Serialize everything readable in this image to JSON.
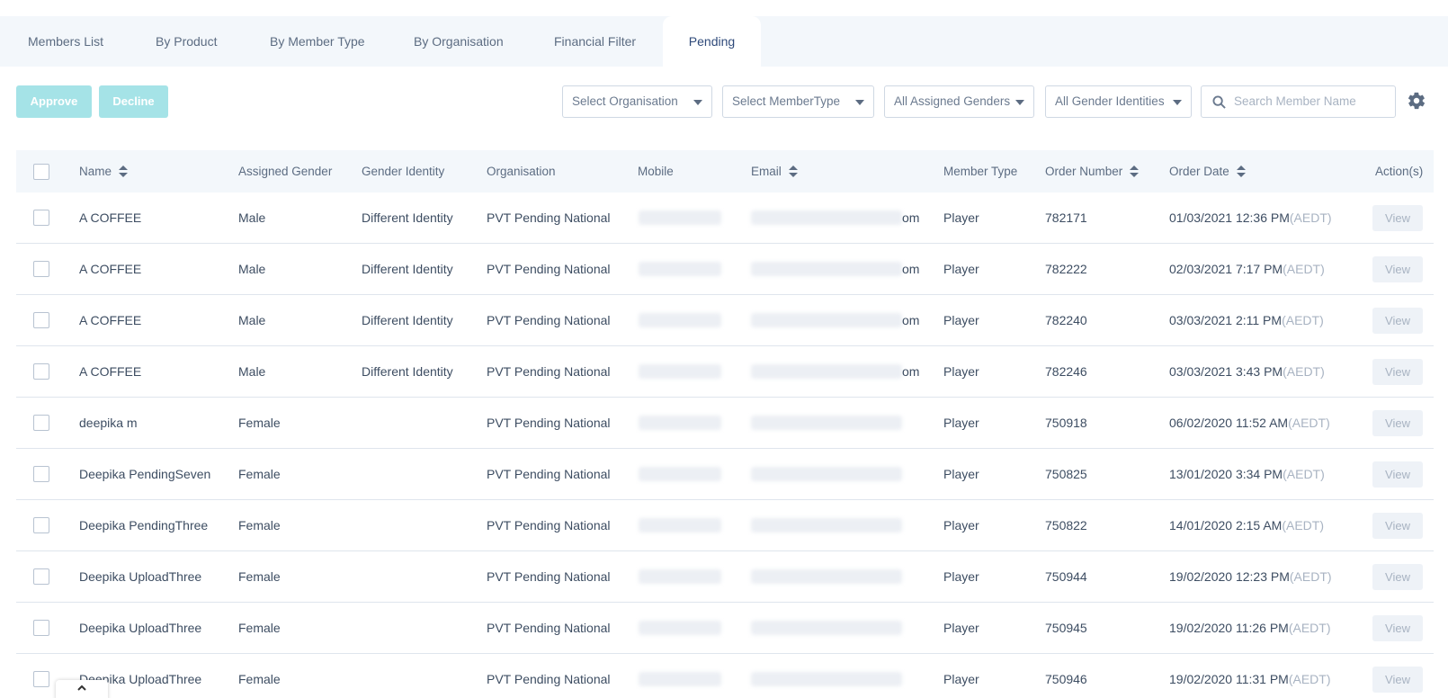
{
  "tabs": [
    {
      "label": "Members List",
      "active": false
    },
    {
      "label": "By Product",
      "active": false
    },
    {
      "label": "By Member Type",
      "active": false
    },
    {
      "label": "By Organisation",
      "active": false
    },
    {
      "label": "Financial Filter",
      "active": false
    },
    {
      "label": "Pending",
      "active": true
    }
  ],
  "toolbar": {
    "approve_label": "Approve",
    "decline_label": "Decline",
    "organisation_select": "Select Organisation",
    "membertype_select": "Select MemberType",
    "assigned_genders_select": "All Assigned Genders",
    "gender_identities_select": "All Gender Identities",
    "search_placeholder": "Search Member Name"
  },
  "table": {
    "headers": {
      "name": "Name",
      "assigned_gender": "Assigned Gender",
      "gender_identity": "Gender Identity",
      "organisation": "Organisation",
      "mobile": "Mobile",
      "email": "Email",
      "member_type": "Member Type",
      "order_number": "Order Number",
      "order_date": "Order Date",
      "actions": "Action(s)"
    },
    "view_label": "View",
    "rows": [
      {
        "name": "A COFFEE",
        "assigned_gender": "Male",
        "gender_identity": "Different Identity",
        "organisation": "PVT Pending National",
        "email_suffix": "om",
        "member_type": "Player",
        "order_number": "782171",
        "order_date": "01/03/2021 12:36 PM",
        "tz": "(AEDT)"
      },
      {
        "name": "A COFFEE",
        "assigned_gender": "Male",
        "gender_identity": "Different Identity",
        "organisation": "PVT Pending National",
        "email_suffix": "om",
        "member_type": "Player",
        "order_number": "782222",
        "order_date": "02/03/2021 7:17 PM",
        "tz": "(AEDT)"
      },
      {
        "name": "A COFFEE",
        "assigned_gender": "Male",
        "gender_identity": "Different Identity",
        "organisation": "PVT Pending National",
        "email_suffix": "om",
        "member_type": "Player",
        "order_number": "782240",
        "order_date": "03/03/2021 2:11 PM",
        "tz": "(AEDT)"
      },
      {
        "name": "A COFFEE",
        "assigned_gender": "Male",
        "gender_identity": "Different Identity",
        "organisation": "PVT Pending National",
        "email_suffix": "om",
        "member_type": "Player",
        "order_number": "782246",
        "order_date": "03/03/2021 3:43 PM",
        "tz": "(AEDT)"
      },
      {
        "name": "deepika m",
        "assigned_gender": "Female",
        "gender_identity": "",
        "organisation": "PVT Pending National",
        "email_suffix": "",
        "member_type": "Player",
        "order_number": "750918",
        "order_date": "06/02/2020 11:52 AM",
        "tz": "(AEDT)"
      },
      {
        "name": "Deepika PendingSeven",
        "assigned_gender": "Female",
        "gender_identity": "",
        "organisation": "PVT Pending National",
        "email_suffix": "",
        "member_type": "Player",
        "order_number": "750825",
        "order_date": "13/01/2020 3:34 PM",
        "tz": "(AEDT)"
      },
      {
        "name": "Deepika PendingThree",
        "assigned_gender": "Female",
        "gender_identity": "",
        "organisation": "PVT Pending National",
        "email_suffix": "",
        "member_type": "Player",
        "order_number": "750822",
        "order_date": "14/01/2020 2:15 AM",
        "tz": "(AEDT)"
      },
      {
        "name": "Deepika UploadThree",
        "assigned_gender": "Female",
        "gender_identity": "",
        "organisation": "PVT Pending National",
        "email_suffix": "",
        "member_type": "Player",
        "order_number": "750944",
        "order_date": "19/02/2020 12:23 PM",
        "tz": "(AEDT)"
      },
      {
        "name": "Deepika UploadThree",
        "assigned_gender": "Female",
        "gender_identity": "",
        "organisation": "PVT Pending National",
        "email_suffix": "",
        "member_type": "Player",
        "order_number": "750945",
        "order_date": "19/02/2020 11:26 PM",
        "tz": "(AEDT)"
      },
      {
        "name": "Deepika UploadThree",
        "assigned_gender": "Female",
        "gender_identity": "",
        "organisation": "PVT Pending National",
        "email_suffix": "",
        "member_type": "Player",
        "order_number": "750946",
        "order_date": "19/02/2020 11:31 PM",
        "tz": "(AEDT)"
      }
    ]
  },
  "icons": {
    "search": "search-icon",
    "settings": "gear-icon",
    "scroll_top": "chevron-up-icon"
  },
  "colors": {
    "accent_button": "#a5e3e7",
    "active_tab_text": "#2f4a7a",
    "header_bg": "#f3f7fb"
  }
}
